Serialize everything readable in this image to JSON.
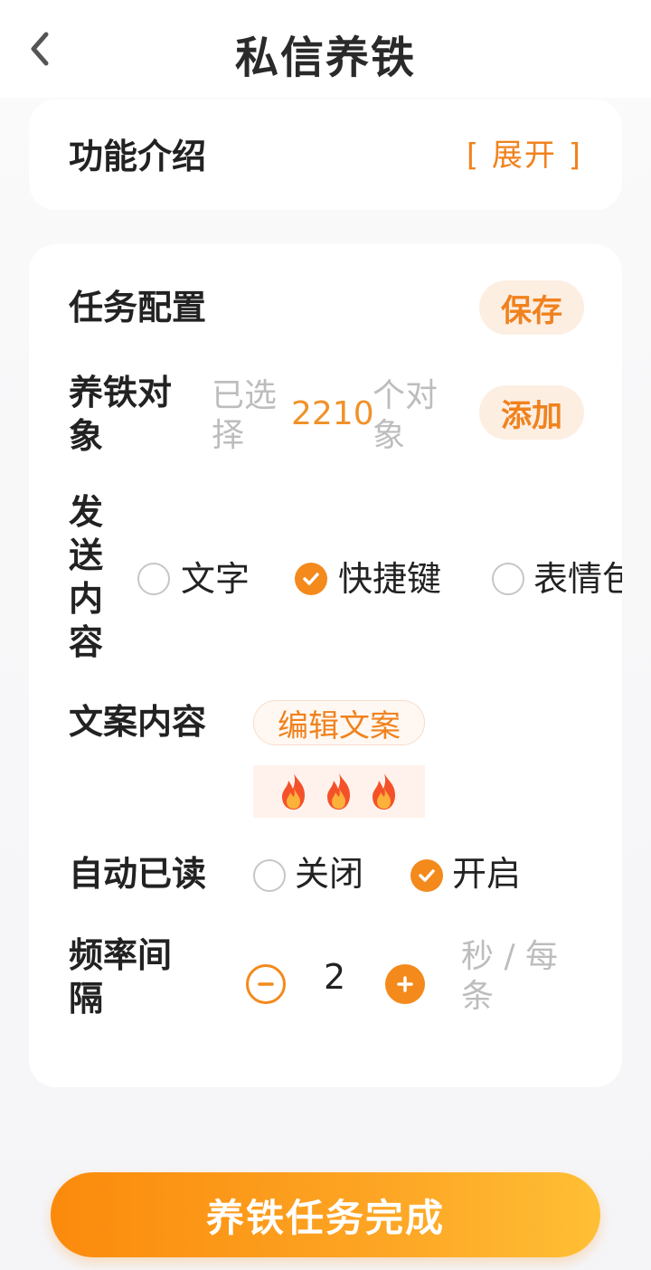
{
  "header": {
    "title": "私信养铁",
    "back_icon": "chevron-left-icon"
  },
  "intro": {
    "label": "功能介绍",
    "toggle": "[ 展开 ]"
  },
  "config": {
    "title": "任务配置",
    "save_label": "保存",
    "target": {
      "label_line1": "养铁对",
      "label_line2": "象",
      "prefix_line1": "已选",
      "prefix_line2": "择",
      "count": "2210",
      "suffix_line1": "个对",
      "suffix_line2": "象",
      "add_label": "添加"
    },
    "send_content": {
      "label_chars": [
        "发",
        "送",
        "内",
        "容"
      ],
      "options": [
        {
          "label": "文字",
          "selected": false
        },
        {
          "label": "快捷键",
          "selected": true
        },
        {
          "label": "表情包",
          "selected": false
        }
      ]
    },
    "copy": {
      "label": "文案内容",
      "edit_label": "编辑文案",
      "preview_icons": [
        "fire-icon",
        "fire-icon",
        "fire-icon"
      ]
    },
    "auto_read": {
      "label": "自动已读",
      "options": [
        {
          "label": "关闭",
          "selected": false
        },
        {
          "label": "开启",
          "selected": true
        }
      ]
    },
    "frequency": {
      "label_line1": "频率间",
      "label_line2": "隔",
      "value": "2",
      "unit_line1": "秒 / 每",
      "unit_line2": "条"
    }
  },
  "complete_button": "养铁任务完成",
  "colors": {
    "accent": "#f38a1b",
    "accent_light": "#fdeee2",
    "gray_text": "#bdbdbd"
  }
}
